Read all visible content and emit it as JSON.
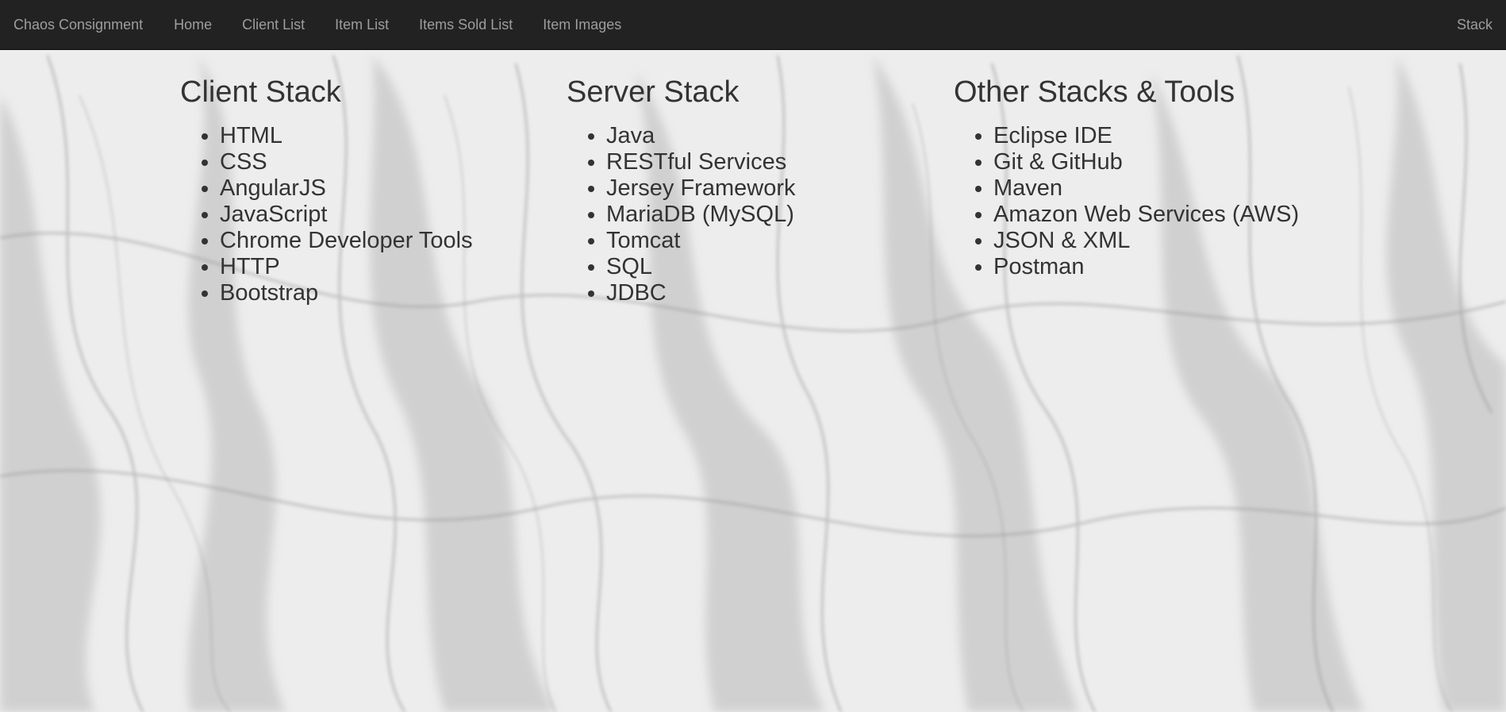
{
  "navbar": {
    "brand": "Chaos Consignment",
    "items": [
      {
        "label": "Home"
      },
      {
        "label": "Client List"
      },
      {
        "label": "Item List"
      },
      {
        "label": "Items Sold List"
      },
      {
        "label": "Item Images"
      }
    ],
    "right_item": "Stack"
  },
  "columns": {
    "client": {
      "title": "Client Stack",
      "items": [
        "HTML",
        "CSS",
        "AngularJS",
        "JavaScript",
        "Chrome Developer Tools",
        "HTTP",
        "Bootstrap"
      ]
    },
    "server": {
      "title": "Server Stack",
      "items": [
        "Java",
        "RESTful Services",
        "Jersey Framework",
        "MariaDB (MySQL)",
        "Tomcat",
        "SQL",
        "JDBC"
      ]
    },
    "other": {
      "title": "Other Stacks & Tools",
      "items": [
        "Eclipse IDE",
        "Git & GitHub",
        "Maven",
        "Amazon Web Services (AWS)",
        "JSON & XML",
        "Postman"
      ]
    }
  },
  "colors": {
    "navbar_bg": "#222222",
    "nav_text": "#9d9d9d",
    "body_text": "#333333"
  },
  "icons": {
    "background": "smoke-background-image"
  }
}
